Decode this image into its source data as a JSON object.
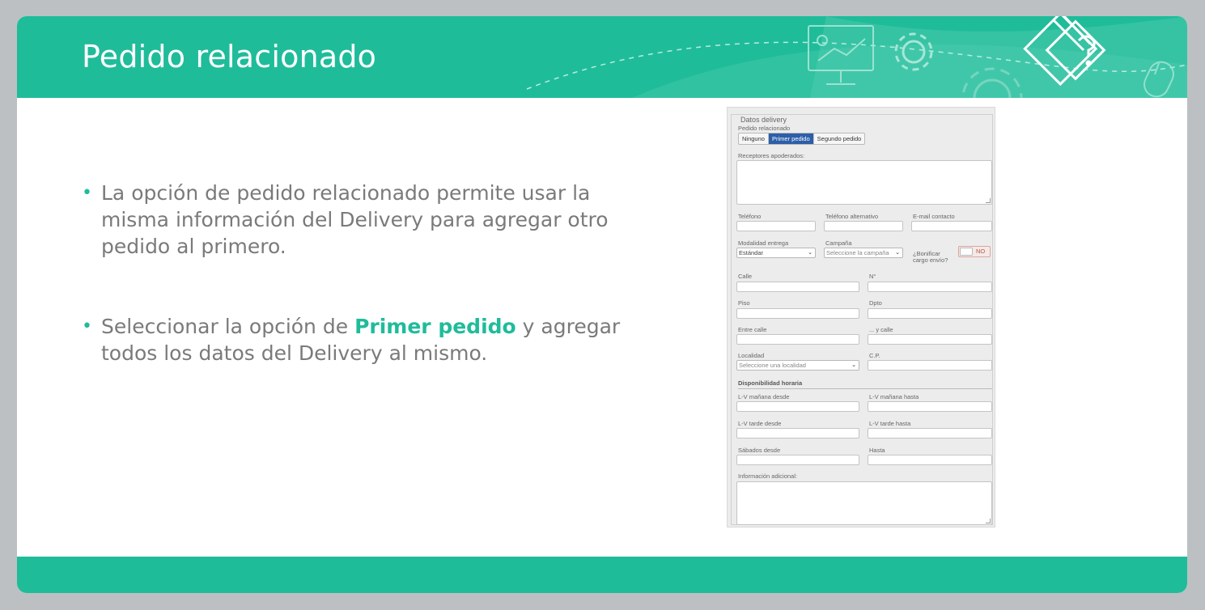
{
  "slide": {
    "title": "Pedido relacionado",
    "bullets": [
      {
        "text": "La opción de pedido relacionado permite usar la misma información del Delivery para agregar otro pedido al primero."
      },
      {
        "before": "Seleccionar la opción de ",
        "highlight": "Primer pedido",
        "after": " y agregar todos los datos del Delivery al mismo."
      }
    ]
  },
  "colors": {
    "accent": "#1fbc9a",
    "active_button": "#2d5ea8",
    "body_text": "#7a7a7a"
  },
  "form": {
    "legend": "Datos delivery",
    "pedido_relacionado_label": "Pedido relacionado",
    "pedido_options": [
      "Ninguno",
      "Primer pedido",
      "Segundo pedido"
    ],
    "pedido_selected": "Primer pedido",
    "receptores_label": "Receptores apoderados:",
    "telefono_label": "Teléfono",
    "telefono_alt_label": "Teléfono alternativo",
    "email_label": "E-mail contacto",
    "modalidad_label": "Modalidad entrega",
    "modalidad_value": "Estándar",
    "campana_label": "Campaña",
    "campana_value": "Seleccione la campaña",
    "bonificar_label_1": "¿Bonificar",
    "bonificar_label_2": "cargo envío?",
    "bonificar_value": "NO",
    "calle_label": "Calle",
    "numero_label": "N°",
    "piso_label": "Piso",
    "dpto_label": "Dpto",
    "entre_calle_label": "Entre calle",
    "y_calle_label": "... y calle",
    "localidad_label": "Localidad",
    "localidad_value": "Seleccione una localidad",
    "cp_label": "C.P.",
    "disponibilidad_label": "Disponibilidad horaria",
    "lv_manana_desde_label": "L-V mañana desde",
    "lv_manana_hasta_label": "L-V mañana hasta",
    "lv_tarde_desde_label": "L-V tarde desde",
    "lv_tarde_hasta_label": "L-V tarde hasta",
    "sabados_desde_label": "Sábados desde",
    "hasta_label": "Hasta",
    "info_adicional_label": "Información adicional:"
  },
  "icons": [
    "presentation-board-icon",
    "gear-icon",
    "pencil-badge-icon",
    "mouse-icon"
  ]
}
